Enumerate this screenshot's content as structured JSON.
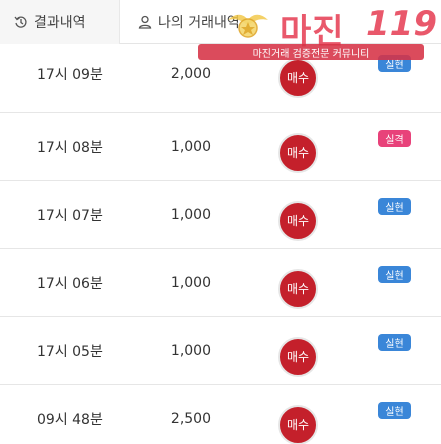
{
  "tabs": [
    {
      "label": "결과내역",
      "icon": "history-icon"
    },
    {
      "label": "나의 거래내역",
      "icon": "user-icon"
    }
  ],
  "rows": [
    {
      "time": "17시 09분",
      "qty": "2,000",
      "action": "매수",
      "badge": "실현",
      "badge_type": "real"
    },
    {
      "time": "17시 08분",
      "qty": "1,000",
      "action": "매수",
      "badge": "실격",
      "badge_type": "sim"
    },
    {
      "time": "17시 07분",
      "qty": "1,000",
      "action": "매수",
      "badge": "실현",
      "badge_type": "real"
    },
    {
      "time": "17시 06분",
      "qty": "1,000",
      "action": "매수",
      "badge": "실현",
      "badge_type": "real"
    },
    {
      "time": "17시 05분",
      "qty": "1,000",
      "action": "매수",
      "badge": "실현",
      "badge_type": "real"
    },
    {
      "time": "09시 48분",
      "qty": "2,500",
      "action": "매수",
      "badge": "실현",
      "badge_type": "real"
    }
  ],
  "watermark": {
    "title": "마진",
    "number": "119",
    "banner": "마진거래 검증전문 커뮤니티"
  },
  "colors": {
    "buy": "#c4202b",
    "badge_real": "#3a86d8",
    "badge_sim": "#e8427a",
    "watermark": "#e84a5f"
  }
}
